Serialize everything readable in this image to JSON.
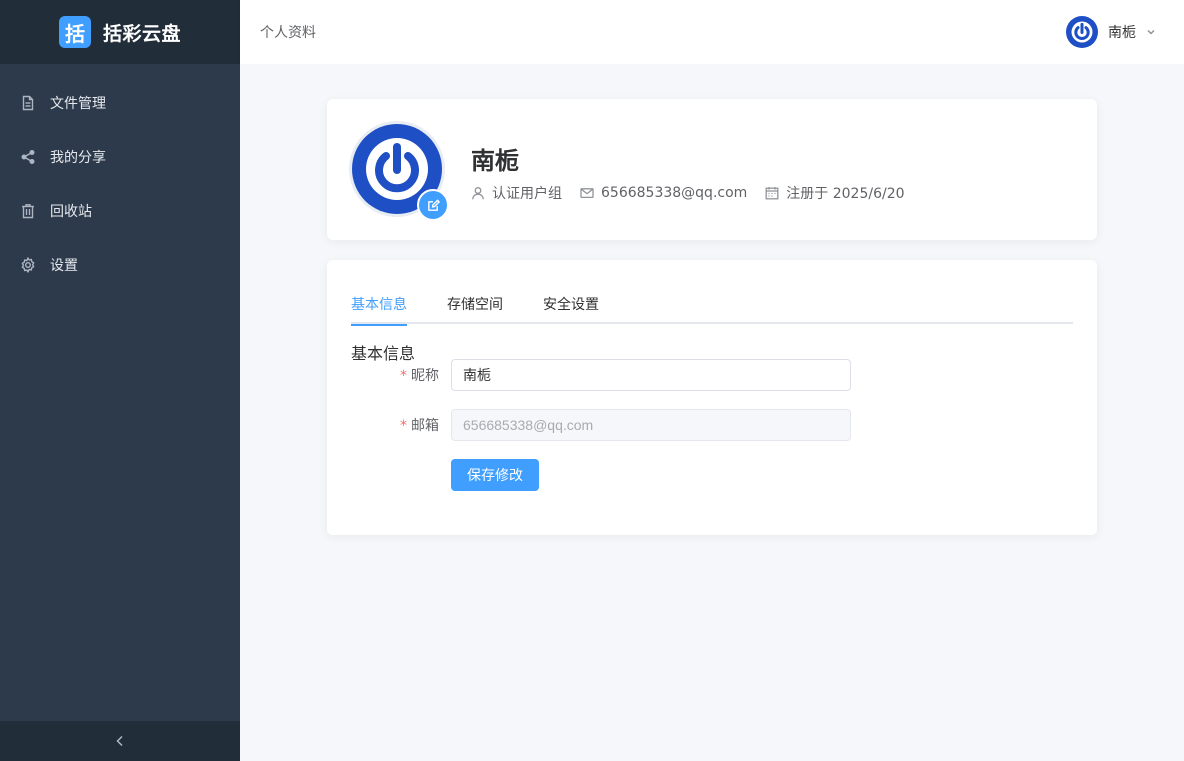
{
  "app": {
    "logo_char": "括",
    "name": "括彩云盘",
    "accent": "#409eff",
    "sidebar_bg": "#2c3a4b"
  },
  "sidebar": {
    "items": [
      {
        "label": "文件管理",
        "icon": "file-icon"
      },
      {
        "label": "我的分享",
        "icon": "share-icon"
      },
      {
        "label": "回收站",
        "icon": "trash-icon"
      },
      {
        "label": "设置",
        "icon": "gear-icon"
      }
    ],
    "collapse_icon": "chevron-left-icon"
  },
  "header": {
    "breadcrumb": "个人资料",
    "username": "南栀"
  },
  "profile": {
    "name": "南栀",
    "group": "认证用户组",
    "email": "656685338@qq.com",
    "registered": "注册于 2025/6/20"
  },
  "tabs": [
    {
      "label": "基本信息",
      "active": true
    },
    {
      "label": "存储空间",
      "active": false
    },
    {
      "label": "安全设置",
      "active": false
    }
  ],
  "form": {
    "section_title": "基本信息",
    "nickname_label": "昵称",
    "nickname_value": "南栀",
    "email_label": "邮箱",
    "email_value": "656685338@qq.com",
    "save_label": "保存修改",
    "required_mark": "*"
  }
}
